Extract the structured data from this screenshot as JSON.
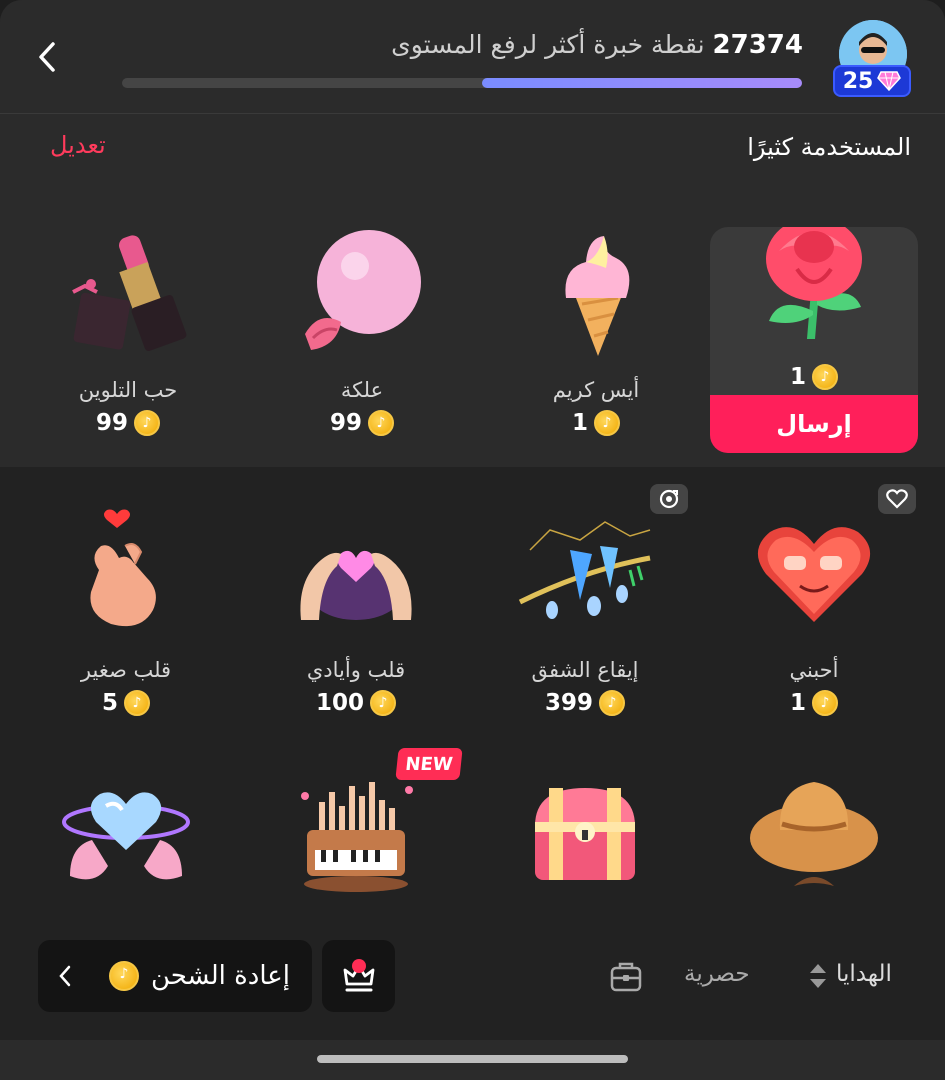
{
  "header": {
    "xp_points": "27374",
    "xp_description": "نقطة خبرة أكثر لرفع المستوى",
    "progress_fraction": 0.47,
    "level": "25"
  },
  "frequent": {
    "title": "المستخدمة كثيرًا",
    "edit_label": "تعديل",
    "send_label": "إرسال",
    "selected": {
      "price": "1"
    },
    "gifts": [
      {
        "name": "أيس كريم",
        "price": "1"
      },
      {
        "name": "علكة",
        "price": "99"
      },
      {
        "name": "حب التلوين",
        "price": "99"
      }
    ]
  },
  "grid": {
    "row1": [
      {
        "name": "أحبني",
        "price": "1"
      },
      {
        "name": "إيقاع الشفق",
        "price": "399"
      },
      {
        "name": "قلب وأيادي",
        "price": "100"
      },
      {
        "name": "قلب صغير",
        "price": "5"
      }
    ],
    "new_badge": "NEW"
  },
  "bottom": {
    "recharge_label": "إعادة الشحن",
    "tab_exclusive": "حصرية",
    "tab_gifts": "الهدايا"
  },
  "colors": {
    "accent": "#ff1f5a",
    "edit": "#ff3b5c",
    "coin": "#f6c744",
    "level_badge": "#1d39d6"
  }
}
